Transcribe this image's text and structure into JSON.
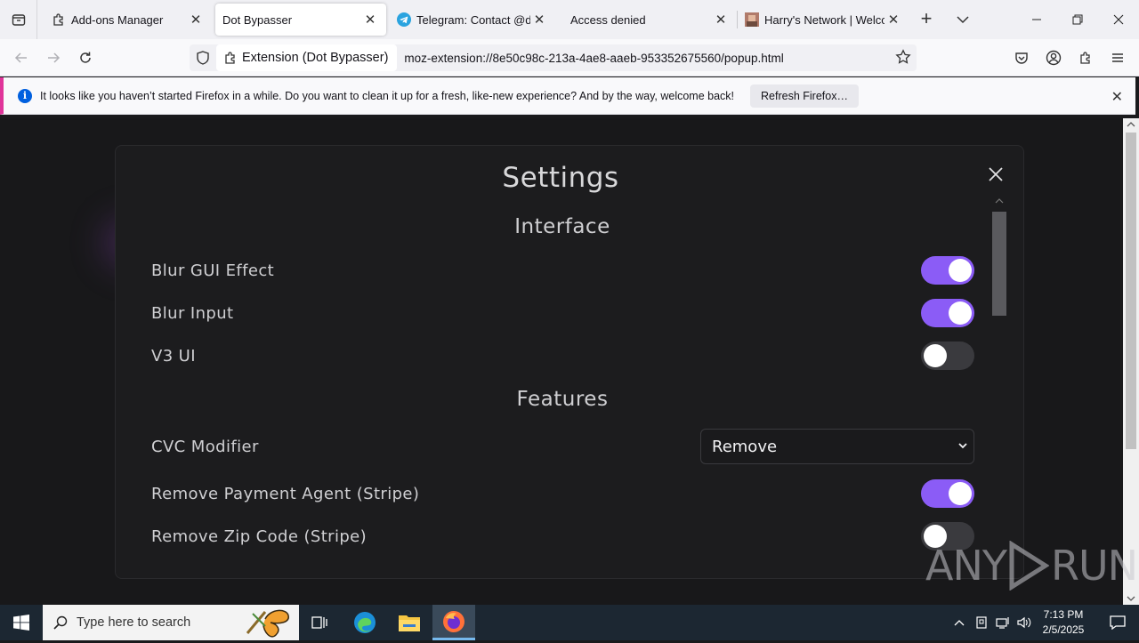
{
  "tabs": [
    {
      "label": "Add-ons Manager",
      "icon": "puzzle-icon",
      "active": false
    },
    {
      "label": "Dot Bypasser",
      "icon": "none",
      "active": true
    },
    {
      "label": "Telegram: Contact @dot_l",
      "icon": "telegram-icon",
      "active": false
    },
    {
      "label": "Access denied",
      "icon": "none",
      "active": false
    },
    {
      "label": "Harry's Network | Welcom",
      "icon": "site-favicon",
      "active": false
    }
  ],
  "urlbar": {
    "extension_chip": "Extension (Dot Bypasser)",
    "url": "moz-extension://8e50c98c-213a-4ae8-aaeb-953352675560/popup.html"
  },
  "notification": {
    "message": "It looks like you haven’t started Firefox in a while. Do you want to clean it up for a fresh, like-new experience? And by the way, welcome back!",
    "button": "Refresh Firefox…"
  },
  "settings": {
    "title": "Settings",
    "interface_heading": "Interface",
    "features_heading": "Features",
    "rows": [
      {
        "label": "Blur GUI Effect",
        "enabled": true
      },
      {
        "label": "Blur Input",
        "enabled": true
      },
      {
        "label": "V3 UI",
        "enabled": false
      }
    ],
    "cvc_label": "CVC Modifier",
    "cvc_value": "Remove",
    "feature_rows": [
      {
        "label": "Remove Payment Agent (Stripe)",
        "enabled": true
      },
      {
        "label": "Remove Zip Code (Stripe)",
        "enabled": false
      }
    ],
    "accent_color": "#8b5cf6"
  },
  "watermark": {
    "left": "ANY",
    "right": "RUN"
  },
  "taskbar": {
    "search_placeholder": "Type here to search",
    "time": "7:13 PM",
    "date": "2/5/2025"
  }
}
